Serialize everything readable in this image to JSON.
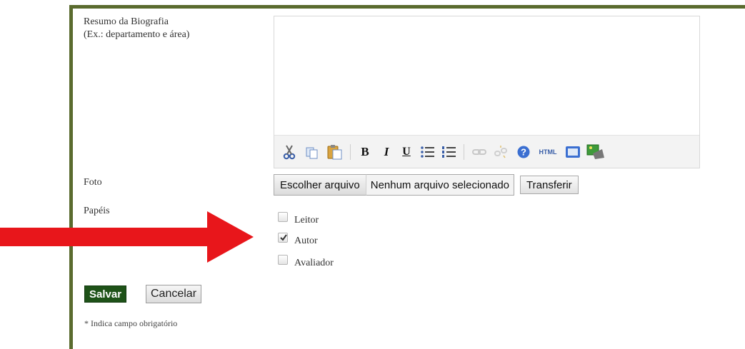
{
  "form": {
    "bio_label_line1": "Resumo da Biografia",
    "bio_label_line2": "(Ex.: departamento e área)",
    "photo_label": "Foto",
    "roles_label": "Papéis"
  },
  "editor": {
    "value": "",
    "toolbar": [
      "cut-icon",
      "copy-icon",
      "paste-icon",
      "bold-icon",
      "italic-icon",
      "underline-icon",
      "bullet-list-icon",
      "numbered-list-icon",
      "link-icon",
      "unlink-icon",
      "help-icon",
      "html-icon",
      "fullscreen-icon",
      "image-icon"
    ]
  },
  "file": {
    "choose_label": "Escolher arquivo",
    "status": "Nenhum arquivo selecionado",
    "upload_label": "Transferir"
  },
  "roles": [
    {
      "label": "Leitor",
      "checked": false
    },
    {
      "label": "Autor",
      "checked": true
    },
    {
      "label": "Avaliador",
      "checked": false
    }
  ],
  "actions": {
    "save_label": "Salvar",
    "cancel_label": "Cancelar"
  },
  "footer": {
    "required_note": "* Indica campo obrigatório"
  },
  "colors": {
    "frame": "#5a6b2e",
    "save_bg": "#1e5218",
    "arrow": "#e8161b"
  }
}
